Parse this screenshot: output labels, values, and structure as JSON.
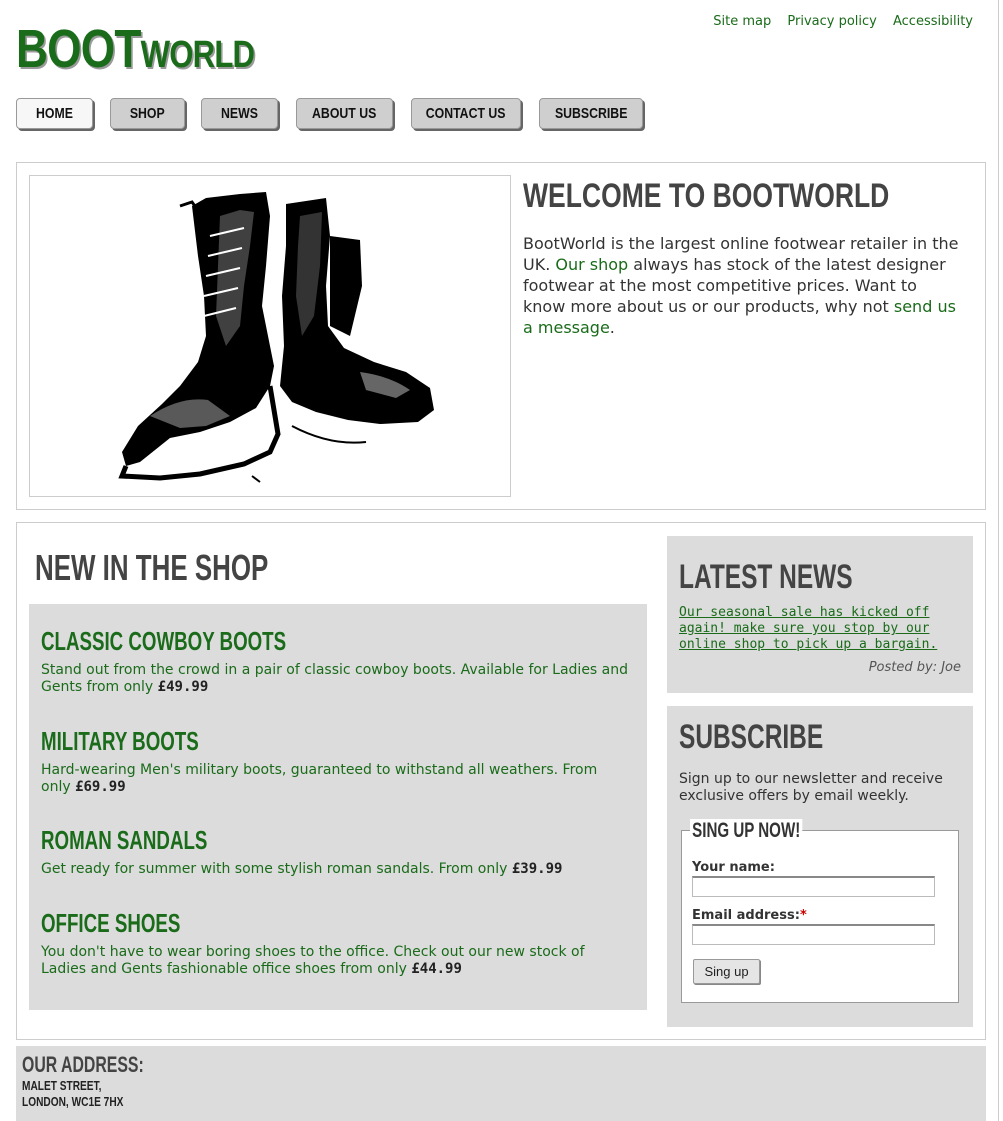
{
  "header": {
    "logo_big": "BOOT",
    "logo_small": "WORLD",
    "util_links": [
      {
        "label": "Site map"
      },
      {
        "label": "Privacy policy"
      },
      {
        "label": "Accessibility"
      }
    ]
  },
  "nav": {
    "items": [
      {
        "label": "HOME",
        "active": true
      },
      {
        "label": "SHOP",
        "active": false
      },
      {
        "label": "NEWS",
        "active": false
      },
      {
        "label": "ABOUT US",
        "active": false
      },
      {
        "label": "CONTACT US",
        "active": false
      },
      {
        "label": "SUBSCRIBE",
        "active": false
      }
    ]
  },
  "welcome": {
    "title": "WELCOME TO BOOTWORLD",
    "text_1": "BootWorld is the largest online footwear retailer in the UK. ",
    "shop_link": "Our shop",
    "text_2": " always has stock of the latest designer footwear at the most competitive prices. Want to know more about us or our products, why not ",
    "message_link": "send us a message",
    "text_3": "."
  },
  "shop": {
    "title": "NEW IN THE SHOP",
    "products": [
      {
        "name": "CLASSIC COWBOY BOOTS",
        "desc": "Stand out from the crowd in a pair of classic cowboy boots. Available for Ladies and Gents from only ",
        "price": "£49.99"
      },
      {
        "name": "MILITARY BOOTS",
        "desc": "Hard-wearing Men's military boots, guaranteed to withstand all weathers. From only ",
        "price": "£69.99"
      },
      {
        "name": "ROMAN SANDALS",
        "desc": "Get ready for summer with some stylish roman sandals. From only ",
        "price": "£39.99"
      },
      {
        "name": "OFFICE SHOES",
        "desc": "You don't have to wear boring shoes to the office. Check out our new stock of Ladies and Gents fashionable office shoes from only ",
        "price": "£44.99"
      }
    ]
  },
  "news": {
    "title": "LATEST NEWS",
    "link": "Our seasonal sale has kicked off again! make sure you stop by our online shop to pick up a bargain.",
    "posted": "Posted by: Joe"
  },
  "subscribe": {
    "title": "SUBSCRIBE",
    "text": "Sign up to our newsletter and receive exclusive offers by email weekly.",
    "legend": "SING UP NOW!",
    "name_label": "Your name:",
    "name_value": "",
    "email_label": "Email address:",
    "required_mark": "*",
    "email_value": "",
    "button": "Sing up"
  },
  "footer": {
    "title": "OUR ADDRESS:",
    "line_1": "MALET STREET,",
    "line_2": "LONDON, WC1E 7HX"
  },
  "colors": {
    "brand_green": "#1a6b1a",
    "panel_grey": "#dcdcdc",
    "heading_grey": "#444444"
  }
}
